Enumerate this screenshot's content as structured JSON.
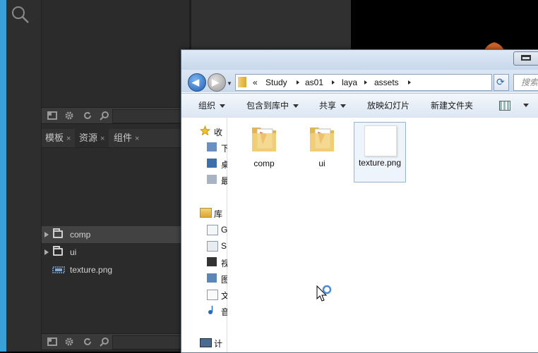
{
  "ide": {
    "tabs": [
      {
        "label": "模板",
        "close": "×"
      },
      {
        "label": "资源",
        "close": "×"
      },
      {
        "label": "组件",
        "close": "×"
      }
    ],
    "tree": [
      {
        "label": "comp"
      },
      {
        "label": "ui"
      },
      {
        "label": "texture.png"
      }
    ]
  },
  "explorer": {
    "breadcrumb": {
      "overflow": "«",
      "parts": [
        "Study",
        "as01",
        "laya",
        "assets"
      ]
    },
    "search_placeholder": "搜索",
    "commands": [
      "组织",
      "包含到库中",
      "共享",
      "放映幻灯片",
      "新建文件夹"
    ],
    "nav_pane": {
      "favorites": "收",
      "fav_items": [
        "下",
        "桌",
        "最"
      ],
      "libraries": "库",
      "lib_items": [
        "G",
        "S",
        "视",
        "图",
        "文",
        "音"
      ],
      "computer": "计"
    },
    "files": [
      {
        "name": "comp",
        "type": "folder"
      },
      {
        "name": "ui",
        "type": "folder"
      },
      {
        "name": "texture.png",
        "type": "image"
      }
    ]
  },
  "colors": {
    "accent_blue": "#3aa0d8",
    "ide_bg": "#2b2b2b",
    "selection": "#424242"
  }
}
